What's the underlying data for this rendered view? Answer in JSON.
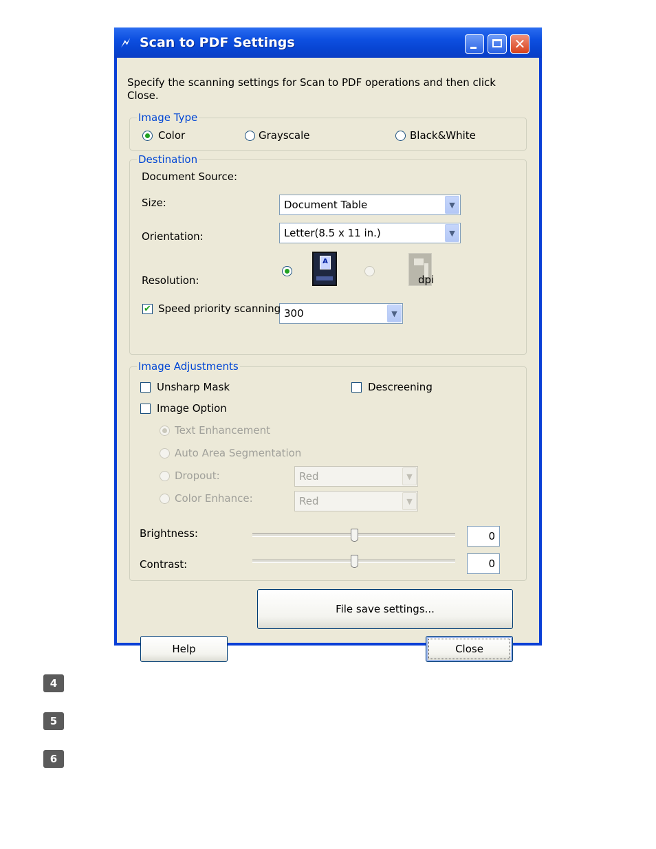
{
  "window": {
    "title": "Scan to PDF Settings",
    "title_icon": "scan-feather-icon",
    "buttons": {
      "minimize_icon": "minimize-icon",
      "maximize_icon": "maximize-icon",
      "close_icon": "close-icon",
      "close_glyph": "✕"
    }
  },
  "intro_text_line1": "Specify the scanning settings for Scan to PDF operations and then click",
  "intro_text_line2": "Close.",
  "image_type": {
    "legend": "Image Type",
    "options": [
      {
        "label": "Color",
        "selected": true
      },
      {
        "label": "Grayscale",
        "selected": false
      },
      {
        "label": "Black&White",
        "selected": false
      }
    ]
  },
  "destination": {
    "legend": "Destination",
    "document_source_label": "Document Source:",
    "document_source_value": "Document Table",
    "size_label": "Size:",
    "size_value": "Letter(8.5 x 11 in.)",
    "orientation_label": "Orientation:",
    "orientation_selected": "portrait",
    "resolution_label": "Resolution:",
    "resolution_value": "300",
    "resolution_unit": "dpi",
    "speed_priority_label": "Speed priority scanning",
    "speed_priority_checked": true,
    "check_glyph": "✔"
  },
  "image_adjustments": {
    "legend": "Image Adjustments",
    "unsharp_mask_label": "Unsharp Mask",
    "unsharp_mask_checked": false,
    "descreening_label": "Descreening",
    "descreening_checked": false,
    "image_option_label": "Image Option",
    "image_option_checked": false,
    "text_enhancement_label": "Text Enhancement",
    "auto_area_label": "Auto Area Segmentation",
    "dropout_label": "Dropout:",
    "dropout_value": "Red",
    "color_enhance_label": "Color Enhance:",
    "color_enhance_value": "Red",
    "brightness_label": "Brightness:",
    "brightness_value": "0",
    "contrast_label": "Contrast:",
    "contrast_value": "0"
  },
  "file_save_button": "File save settings...",
  "help_button": "Help",
  "close_button": "Close",
  "dropdown_arrow": "▼",
  "step_badges": [
    "4",
    "5",
    "6"
  ]
}
